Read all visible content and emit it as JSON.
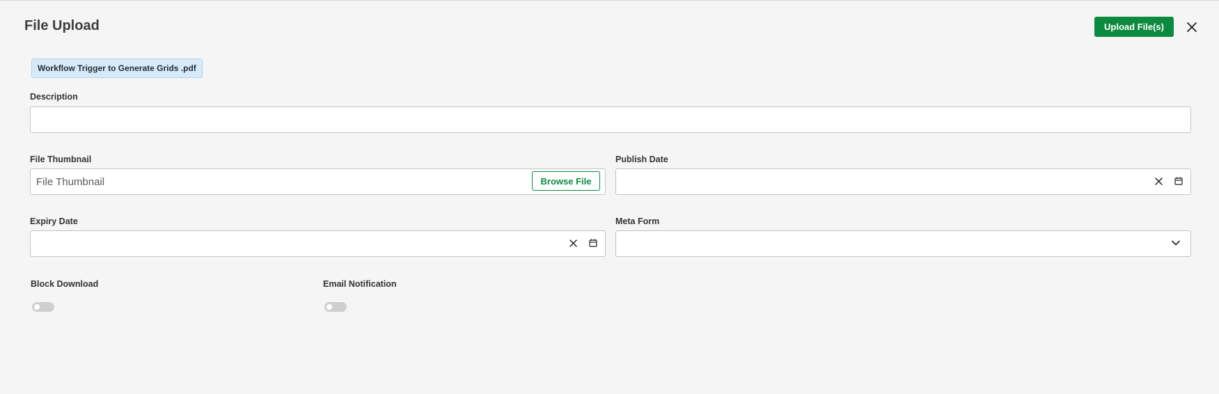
{
  "modal": {
    "title": "File Upload",
    "upload_button": "Upload File(s)",
    "close_icon": "close-icon"
  },
  "attached_file": {
    "name": "Workflow Trigger to Generate Grids .pdf"
  },
  "description": {
    "label": "Description",
    "value": "",
    "placeholder": ""
  },
  "file_thumbnail": {
    "label": "File Thumbnail",
    "placeholder": "File Thumbnail",
    "value": "",
    "browse_button": "Browse File"
  },
  "publish_date": {
    "label": "Publish Date",
    "value": "",
    "clear_icon": "close-icon",
    "calendar_icon": "calendar-icon"
  },
  "expiry_date": {
    "label": "Expiry Date",
    "value": "",
    "clear_icon": "close-icon",
    "calendar_icon": "calendar-icon"
  },
  "meta_form": {
    "label": "Meta Form",
    "selected": "",
    "dropdown_icon": "chevron-down-icon"
  },
  "block_download": {
    "label": "Block Download",
    "enabled": false
  },
  "email_notification": {
    "label": "Email Notification",
    "enabled": false
  },
  "colors": {
    "primary": "#0c8a3f",
    "background": "#f5f5f5",
    "chip_background": "#d8eaf8",
    "toggle_off": "#cfcfcf"
  }
}
